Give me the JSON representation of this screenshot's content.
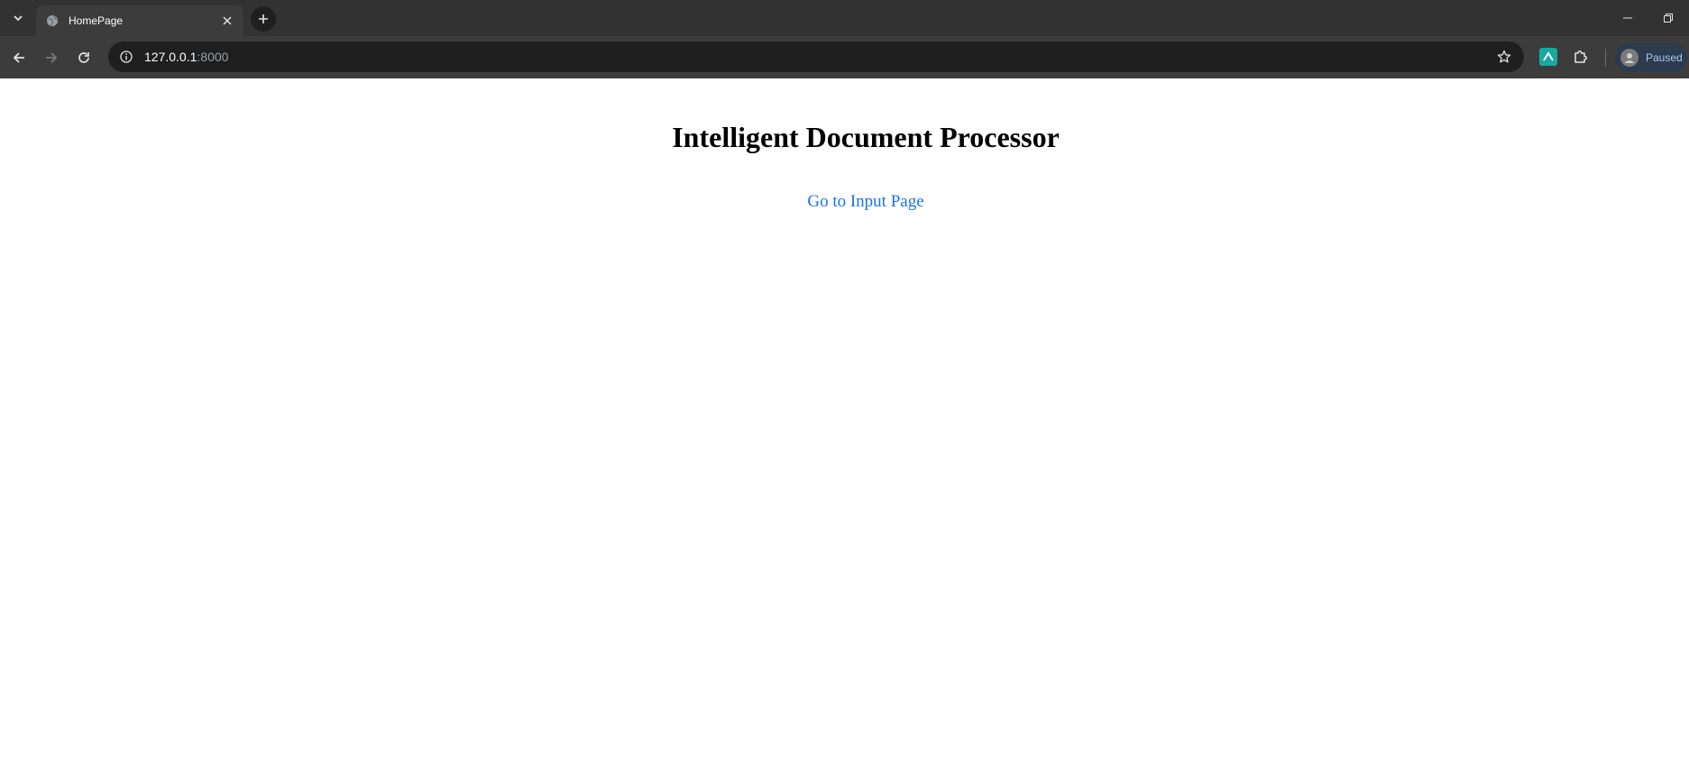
{
  "browser": {
    "tab": {
      "title": "HomePage"
    },
    "address_bar": {
      "host": "127.0.0.1",
      "port": ":8000"
    },
    "profile": {
      "label": "Paused"
    },
    "icons": {
      "tab_search": "chevron-down-icon",
      "favicon": "globe-icon",
      "tab_close": "close-icon",
      "new_tab": "plus-icon",
      "back": "arrow-left-icon",
      "forward": "arrow-right-icon",
      "reload": "reload-icon",
      "site_info": "info-icon",
      "bookmark": "star-icon",
      "extension": "puzzle-icon"
    },
    "colors": {
      "link": "#1a73e8",
      "profile_text": "#a8c7fa",
      "extension_green": "#18a9a0"
    }
  },
  "page": {
    "heading": "Intelligent Document Processor",
    "link_text": "Go to Input Page"
  }
}
